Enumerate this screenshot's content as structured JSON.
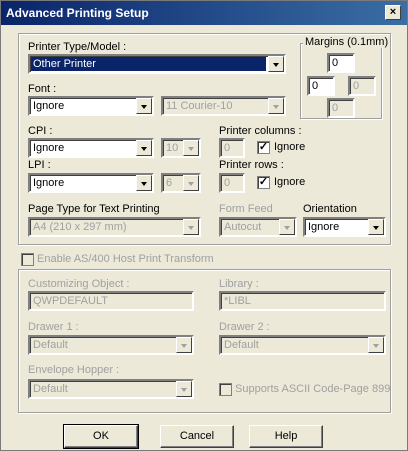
{
  "window": {
    "title": "Advanced Printing Setup",
    "close_glyph": "×"
  },
  "printer": {
    "type_label": "Printer Type/Model :",
    "type_value": "Other Printer",
    "font_label": "Font :",
    "font_value": "Ignore",
    "font_name_value": "11 Courier-10",
    "cpi_label": "CPI :",
    "cpi_value": "Ignore",
    "cpi_num_value": "10",
    "lpi_label": "LPI :",
    "lpi_value": "Ignore",
    "lpi_num_value": "6",
    "columns_label": "Printer columns :",
    "columns_value": "0",
    "columns_ignore_label": "Ignore",
    "rows_label": "Printer rows :",
    "rows_value": "0",
    "rows_ignore_label": "Ignore",
    "page_type_label": "Page Type for Text Printing",
    "page_type_value": "A4 (210 x 297 mm)",
    "form_feed_label": "Form Feed",
    "form_feed_value": "Autocut",
    "orientation_label": "Orientation",
    "orientation_value": "Ignore",
    "check_glyph": "✓"
  },
  "margins": {
    "label": "Margins (0.1mm)",
    "top": "0",
    "left": "0",
    "right": "0",
    "bottom": "0"
  },
  "host_transform": {
    "enable_label": "Enable AS/400 Host Print Transform",
    "customizing_object_label": "Customizing Object :",
    "customizing_object_value": "QWPDEFAULT",
    "library_label": "Library :",
    "library_value": "*LIBL",
    "drawer1_label": "Drawer 1 :",
    "drawer1_value": "Default",
    "drawer2_label": "Drawer 2 :",
    "drawer2_value": "Default",
    "envelope_label": "Envelope Hopper :",
    "envelope_value": "Default",
    "ascii_label": "Supports ASCII Code-Page 899"
  },
  "buttons": {
    "ok": "OK",
    "cancel": "Cancel",
    "help": "Help"
  }
}
